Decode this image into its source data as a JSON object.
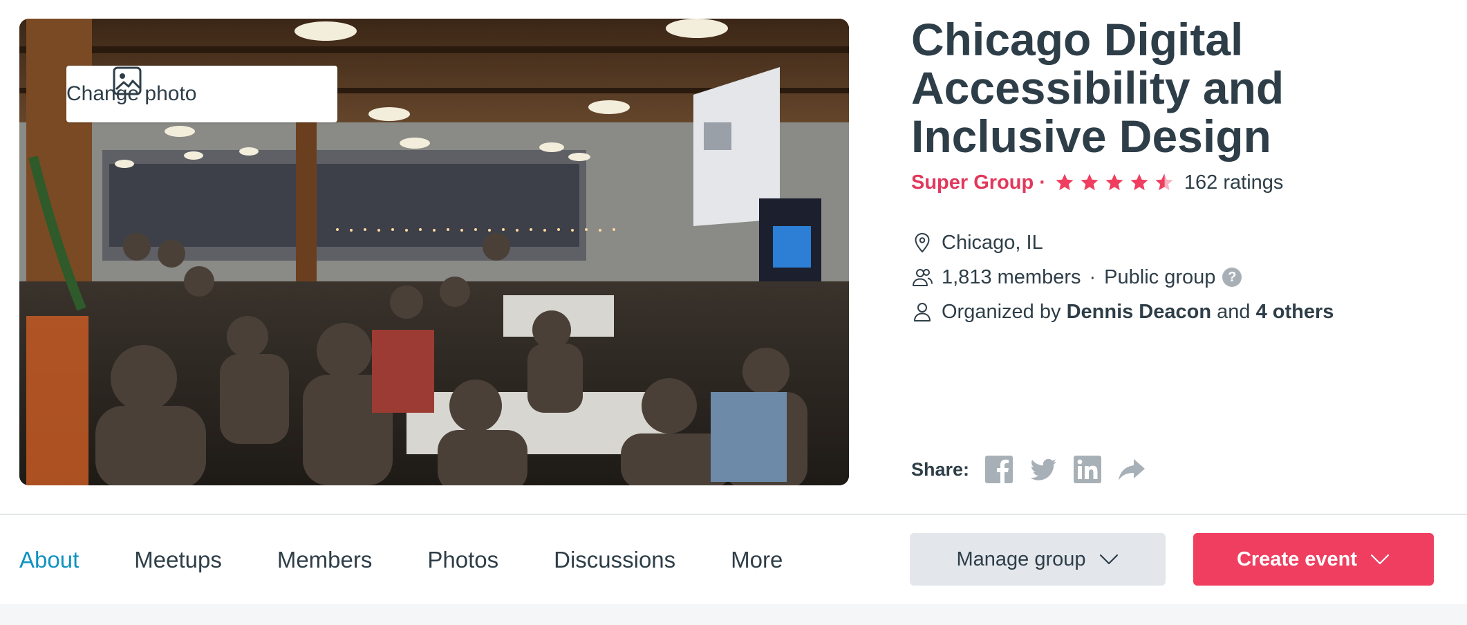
{
  "photo": {
    "change_label": "Change photo",
    "icon": "image-icon"
  },
  "group": {
    "title": "Chicago Digital Accessibility and Inclusive Design",
    "super_label": "Super Group",
    "separator": "·",
    "rating": 4.5,
    "ratings_count": "162 ratings",
    "location": "Chicago, IL",
    "members": "1,813 members",
    "dot": "·",
    "privacy": "Public group",
    "help": "?",
    "organized_prefix": "Organized by",
    "organizer": "Dennis Deacon",
    "and_text": "and",
    "others": "4 others"
  },
  "share": {
    "label": "Share:",
    "icons": [
      "facebook-icon",
      "twitter-icon",
      "linkedin-icon",
      "share-arrow-icon"
    ]
  },
  "nav": {
    "tabs": [
      {
        "label": "About",
        "active": true
      },
      {
        "label": "Meetups"
      },
      {
        "label": "Members"
      },
      {
        "label": "Photos"
      },
      {
        "label": "Discussions"
      },
      {
        "label": "More"
      }
    ],
    "manage_label": "Manage group",
    "create_label": "Create event"
  },
  "colors": {
    "brand_red": "#ef3e5f",
    "accent_blue": "#0f93c2",
    "text_dark": "#2e3e48",
    "share_gray": "#a8b0b7"
  }
}
